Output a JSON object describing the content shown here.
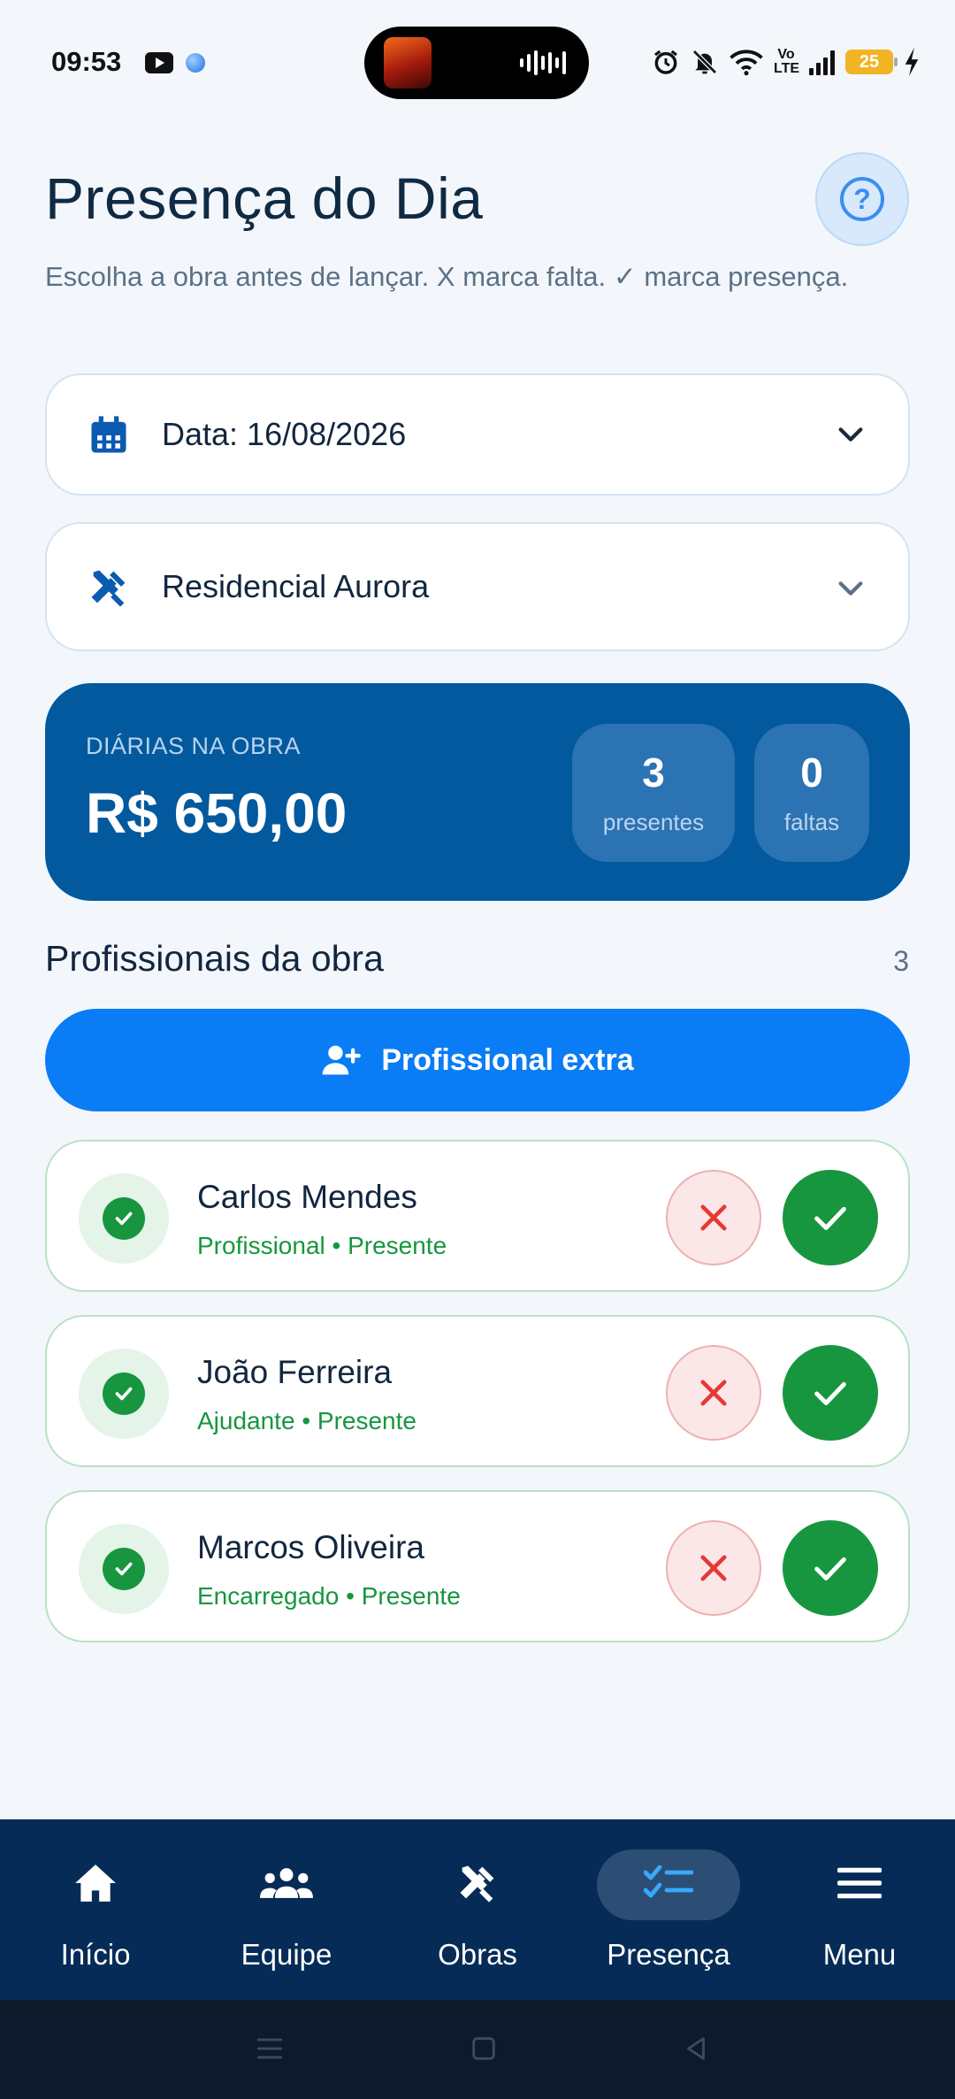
{
  "status_bar": {
    "time": "09:53",
    "network_label": "Vo LTE",
    "battery_level": "25",
    "icons": [
      "youtube-icon",
      "app-dot-icon",
      "alarm-icon",
      "mute-icon",
      "wifi-icon",
      "signal-icon",
      "battery-icon",
      "charging-icon"
    ]
  },
  "header": {
    "title": "Presença do Dia",
    "subtitle": "Escolha a obra antes de lançar. X marca falta. ✓ marca presença.",
    "help_icon": "question-icon"
  },
  "filters": {
    "date_label": "Data: 16/08/2026",
    "site_label": "Residencial Aurora"
  },
  "summary": {
    "label": "DIÁRIAS NA OBRA",
    "value": "R$ 650,00",
    "present_count": "3",
    "present_label": "presentes",
    "absent_count": "0",
    "absent_label": "faltas"
  },
  "workers_section": {
    "title": "Profissionais da obra",
    "count": "3",
    "extra_button_label": "Profissional extra"
  },
  "workers": [
    {
      "name": "Carlos Mendes",
      "meta": "Profissional • Presente",
      "status": "present"
    },
    {
      "name": "João Ferreira",
      "meta": "Ajudante • Presente",
      "status": "present"
    },
    {
      "name": "Marcos Oliveira",
      "meta": "Encarregado • Presente",
      "status": "present"
    }
  ],
  "nav": {
    "items": [
      {
        "label": "Início",
        "icon": "home-icon"
      },
      {
        "label": "Equipe",
        "icon": "team-icon"
      },
      {
        "label": "Obras",
        "icon": "tools-icon"
      },
      {
        "label": "Presença",
        "icon": "checklist-icon",
        "active": true
      },
      {
        "label": "Menu",
        "icon": "menu-icon"
      }
    ]
  },
  "colors": {
    "primary": "#0a7cf5",
    "summary_bg": "#03599e",
    "nav_bg": "#052b56",
    "present": "#17963f",
    "absent": "#e53935"
  }
}
